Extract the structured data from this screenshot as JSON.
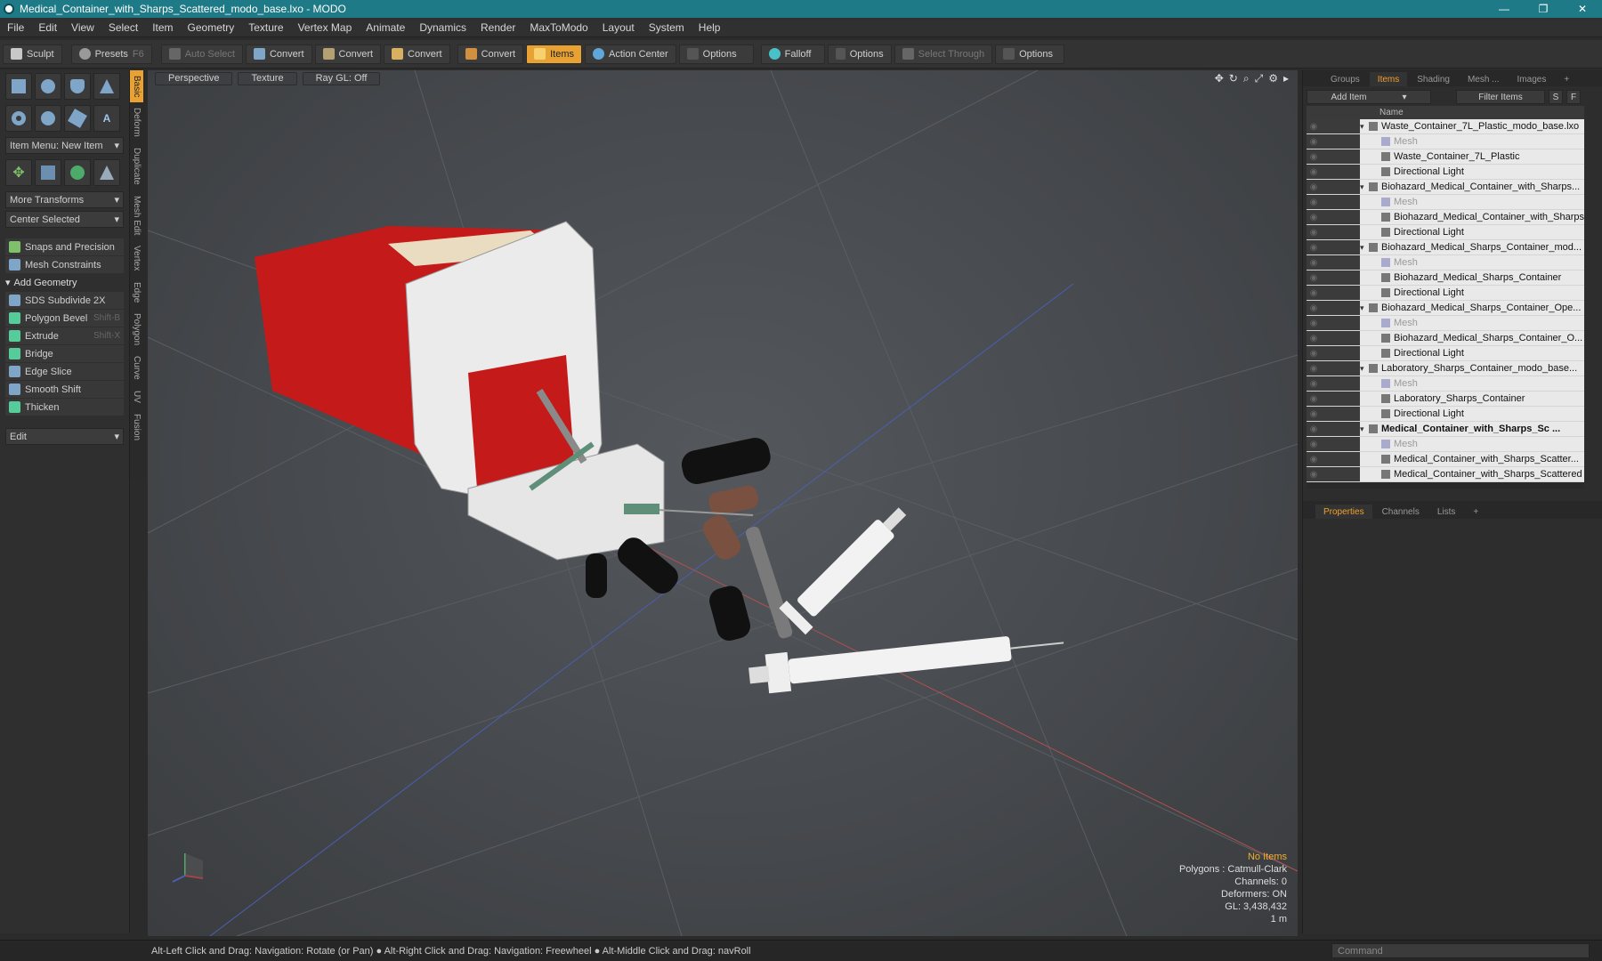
{
  "window": {
    "title": "Medical_Container_with_Sharps_Scattered_modo_base.lxo - MODO"
  },
  "menu": [
    "File",
    "Edit",
    "View",
    "Select",
    "Item",
    "Geometry",
    "Texture",
    "Vertex Map",
    "Animate",
    "Dynamics",
    "Render",
    "MaxToModo",
    "Layout",
    "System",
    "Help"
  ],
  "toolbar": {
    "sculpt": "Sculpt",
    "presets": "Presets",
    "presets_key": "F6",
    "auto_select": "Auto Select",
    "convert1": "Convert",
    "convert2": "Convert",
    "convert3": "Convert",
    "convert4": "Convert",
    "items": "Items",
    "action_center": "Action Center",
    "options1": "Options",
    "falloff": "Falloff",
    "options2": "Options",
    "select_through": "Select Through",
    "options3": "Options"
  },
  "left_panel": {
    "item_menu": "Item Menu: New Item",
    "more_transforms": "More Transforms",
    "center_selected": "Center Selected",
    "snaps": "Snaps and Precision",
    "mesh_constraints": "Mesh Constraints",
    "add_geometry": "Add Geometry",
    "tools": [
      {
        "label": "SDS Subdivide 2X",
        "shortcut": ""
      },
      {
        "label": "Polygon Bevel",
        "shortcut": "Shift-B"
      },
      {
        "label": "Extrude",
        "shortcut": "Shift-X"
      },
      {
        "label": "Bridge",
        "shortcut": ""
      },
      {
        "label": "Edge Slice",
        "shortcut": ""
      },
      {
        "label": "Smooth Shift",
        "shortcut": ""
      },
      {
        "label": "Thicken",
        "shortcut": ""
      }
    ],
    "edit": "Edit"
  },
  "vtabs": [
    "Basic",
    "Deform",
    "Duplicate",
    "Mesh Edit",
    "Vertex",
    "Edge",
    "Polygon",
    "Curve",
    "UV",
    "Fusion"
  ],
  "viewport": {
    "perspective": "Perspective",
    "texture": "Texture",
    "raygl": "Ray GL: Off",
    "hud": {
      "no_items": "No Items",
      "polygons": "Polygons : Catmull-Clark",
      "channels": "Channels: 0",
      "deformers": "Deformers: ON",
      "gl": "GL: 3,438,432",
      "scale": "1 m"
    }
  },
  "right_panel": {
    "tabs": [
      "Groups",
      "Items",
      "Shading",
      "Mesh ...",
      "Images"
    ],
    "add_item": "Add Item",
    "filter_items": "Filter Items",
    "name_col": "Name",
    "tree": [
      {
        "label": "Waste_Container_7L_Plastic_modo_base.lxo",
        "indent": 0,
        "style": ""
      },
      {
        "label": "Mesh",
        "indent": 1,
        "style": "dim"
      },
      {
        "label": "Waste_Container_7L_Plastic",
        "indent": 1,
        "style": ""
      },
      {
        "label": "Directional Light",
        "indent": 1,
        "style": ""
      },
      {
        "label": "Biohazard_Medical_Container_with_Sharps...",
        "indent": 0,
        "style": ""
      },
      {
        "label": "Mesh",
        "indent": 1,
        "style": "dim"
      },
      {
        "label": "Biohazard_Medical_Container_with_Sharps",
        "indent": 1,
        "style": ""
      },
      {
        "label": "Directional Light",
        "indent": 1,
        "style": ""
      },
      {
        "label": "Biohazard_Medical_Sharps_Container_mod...",
        "indent": 0,
        "style": ""
      },
      {
        "label": "Mesh",
        "indent": 1,
        "style": "dim"
      },
      {
        "label": "Biohazard_Medical_Sharps_Container",
        "indent": 1,
        "style": ""
      },
      {
        "label": "Directional Light",
        "indent": 1,
        "style": ""
      },
      {
        "label": "Biohazard_Medical_Sharps_Container_Ope...",
        "indent": 0,
        "style": ""
      },
      {
        "label": "Mesh",
        "indent": 1,
        "style": "dim"
      },
      {
        "label": "Biohazard_Medical_Sharps_Container_O...",
        "indent": 1,
        "style": ""
      },
      {
        "label": "Directional Light",
        "indent": 1,
        "style": ""
      },
      {
        "label": "Laboratory_Sharps_Container_modo_base...",
        "indent": 0,
        "style": ""
      },
      {
        "label": "Mesh",
        "indent": 1,
        "style": "dim"
      },
      {
        "label": "Laboratory_Sharps_Container",
        "indent": 1,
        "style": ""
      },
      {
        "label": "Directional Light",
        "indent": 1,
        "style": ""
      },
      {
        "label": "Medical_Container_with_Sharps_Sc ...",
        "indent": 0,
        "style": "bold"
      },
      {
        "label": "Mesh",
        "indent": 1,
        "style": "dim"
      },
      {
        "label": "Medical_Container_with_Sharps_Scatter...",
        "indent": 1,
        "style": ""
      },
      {
        "label": "Medical_Container_with_Sharps_Scattered",
        "indent": 1,
        "style": ""
      }
    ],
    "prop_tabs": [
      "Properties",
      "Channels",
      "Lists"
    ]
  },
  "status": {
    "hint": "Alt-Left Click and Drag: Navigation: Rotate (or Pan) ● Alt-Right Click and Drag: Navigation: Freewheel ● Alt-Middle Click and Drag: navRoll",
    "command": "Command"
  }
}
